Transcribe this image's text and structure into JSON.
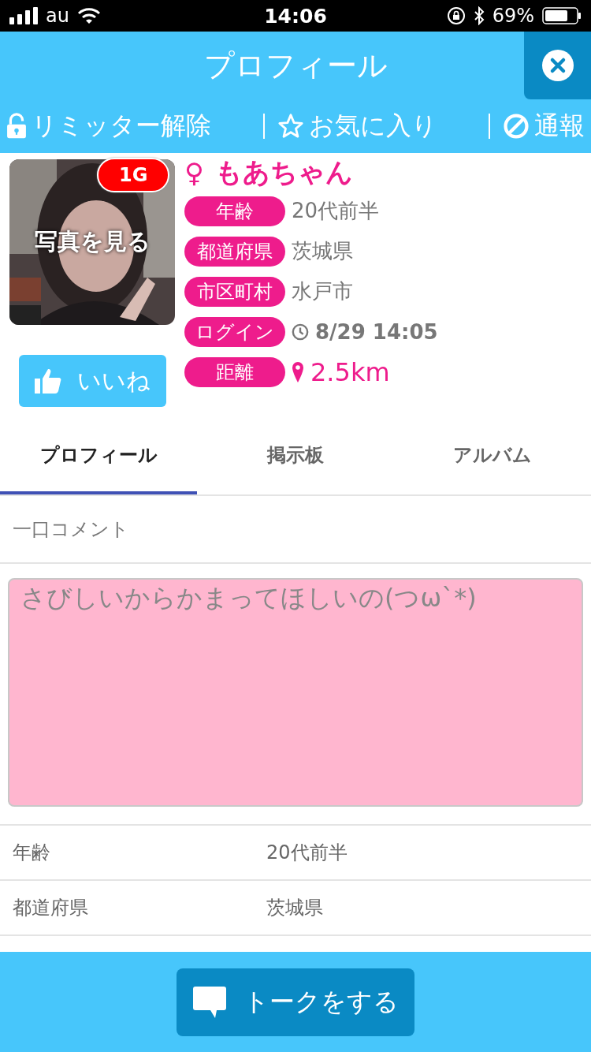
{
  "status_bar": {
    "carrier": "au",
    "time": "14:06",
    "battery": "69%"
  },
  "header": {
    "title": "プロフィール"
  },
  "actions": [
    {
      "kind": "lock",
      "label": "リミッター解除"
    },
    {
      "kind": "star",
      "label": "お気に入り"
    },
    {
      "kind": "ban",
      "label": "通報"
    }
  ],
  "profile": {
    "photo_label": "写真を見る",
    "badge": "1G",
    "gender": "♀",
    "name": "もあちゃん",
    "like_button": "いいね",
    "fields": [
      {
        "kind": "text",
        "label": "年齢",
        "value": "20代前半"
      },
      {
        "kind": "text",
        "label": "都道府県",
        "value": "茨城県"
      },
      {
        "kind": "text",
        "label": "市区町村",
        "value": "水戸市"
      },
      {
        "kind": "time",
        "label": "ログイン",
        "value": "8/29 14:05"
      },
      {
        "kind": "distance",
        "label": "距離",
        "value": "2.5km"
      }
    ]
  },
  "tabs": [
    {
      "label": "プロフィール",
      "selected": true
    },
    {
      "label": "掲示板",
      "selected": false
    },
    {
      "label": "アルバム",
      "selected": false
    }
  ],
  "comment": {
    "label": "一口コメント",
    "text": "さびしいからかまってほしいの(つω`*)"
  },
  "details": [
    {
      "label": "年齢",
      "value": "20代前半"
    },
    {
      "label": "都道府県",
      "value": "茨城県"
    }
  ],
  "footer": {
    "button": "トークをする"
  }
}
